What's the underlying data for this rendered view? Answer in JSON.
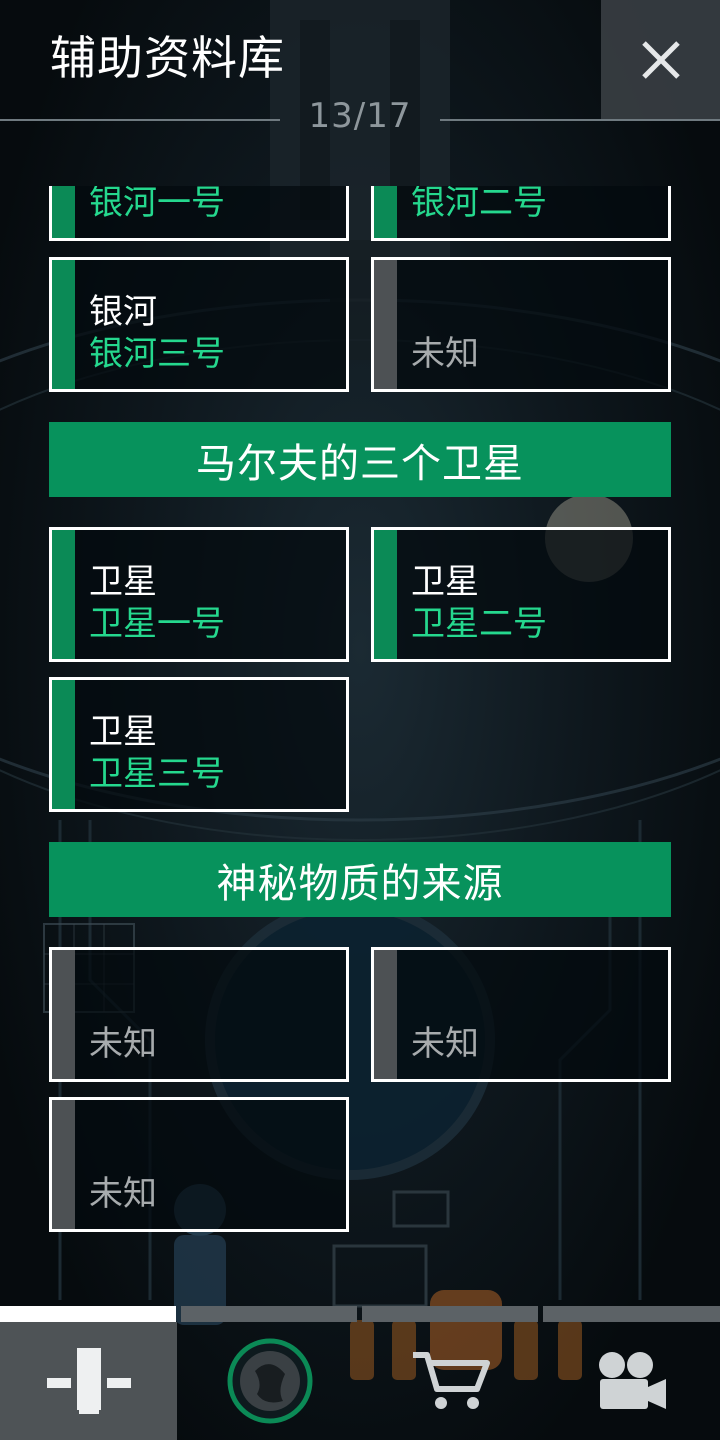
{
  "header": {
    "title": "辅助资料库",
    "page_indicator": "13/17",
    "close_icon": "close-icon"
  },
  "sections": {
    "galaxy": {
      "cards": [
        {
          "category": "",
          "name": "银河一号",
          "locked": false
        },
        {
          "category": "",
          "name": "银河二号",
          "locked": false
        },
        {
          "category": "银河",
          "name": "银河三号",
          "locked": false
        },
        {
          "category": "",
          "name": "未知",
          "locked": true
        }
      ]
    },
    "satellites": {
      "title": "马尔夫的三个卫星",
      "cards": [
        {
          "category": "卫星",
          "name": "卫星一号",
          "locked": false
        },
        {
          "category": "卫星",
          "name": "卫星二号",
          "locked": false
        },
        {
          "category": "卫星",
          "name": "卫星三号",
          "locked": false
        }
      ]
    },
    "matter": {
      "title": "神秘物质的来源",
      "cards": [
        {
          "category": "",
          "name": "未知",
          "locked": true
        },
        {
          "category": "",
          "name": "未知",
          "locked": true
        },
        {
          "category": "",
          "name": "未知",
          "locked": true
        }
      ]
    }
  },
  "nav": {
    "items": [
      {
        "icon": "tower-icon",
        "active": true
      },
      {
        "icon": "planet-icon",
        "active": false
      },
      {
        "icon": "cart-icon",
        "active": false
      },
      {
        "icon": "video-camera-icon",
        "active": false
      }
    ]
  },
  "colors": {
    "accent_green": "#07925c",
    "name_green": "#25d88e",
    "locked_gray": "#4d5154"
  }
}
